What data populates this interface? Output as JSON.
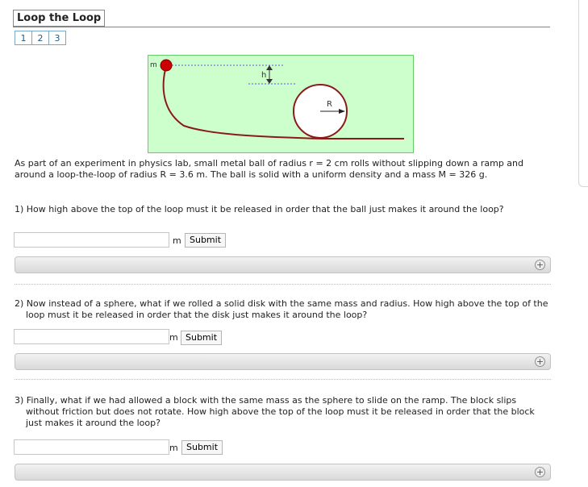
{
  "title": "Loop the Loop",
  "pages": [
    "1",
    "2",
    "3"
  ],
  "diagram": {
    "label_h": "h",
    "label_R": "R",
    "label_m": "m",
    "bg_color": "#ccffcc",
    "border_color": "#66cc66",
    "ball_color": "#cc0000",
    "track_color": "#8b1a1a"
  },
  "intro": "As part of an experiment in physics lab, small metal ball of radius r = 2 cm rolls without slipping down a ramp and around a loop-the-loop of radius R = 3.6 m. The ball is solid with a uniform density and a mass M = 326 g.",
  "questions": [
    {
      "text": "1) How high above the top of the loop must it be released in order that the ball just makes it around the loop?",
      "unit": "m",
      "submit_label": "Submit",
      "value": ""
    },
    {
      "text": "2) Now instead of a sphere, what if we rolled a solid disk with the same mass and radius. How high above the top of the loop must it be released in order that the disk just makes it around the loop?",
      "unit": "m",
      "submit_label": "Submit",
      "value": ""
    },
    {
      "text": "3) Finally, what if we had allowed a block with the same mass as the sphere to slide on the ramp. The block slips without friction but does not rotate. How high above the top of the loop must it be released in order that the block just makes it around the loop?",
      "unit": "m",
      "submit_label": "Submit",
      "value": ""
    }
  ],
  "expand_symbol": "+"
}
